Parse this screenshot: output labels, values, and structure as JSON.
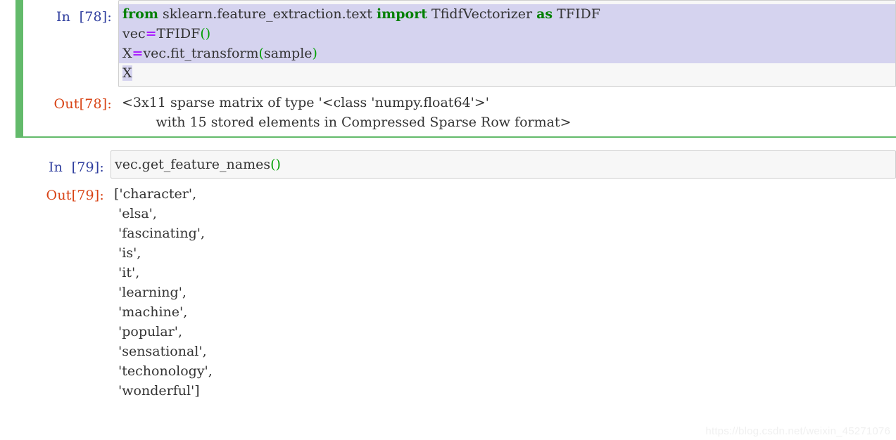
{
  "notebook": {
    "watermark": "https://blog.csdn.net/weixin_45271076",
    "colors": {
      "selection_bar": "#63ba6b",
      "in_prompt": "#303f9f",
      "out_prompt": "#d84315",
      "keyword": "#008000",
      "operator": "#aa22ff",
      "paren": "#00a000",
      "text_selection_highlight": "#d5d3ef",
      "input_background": "#f7f7f7",
      "input_border": "#cfcfcf"
    },
    "cells": [
      {
        "id": "cell-78",
        "selected": true,
        "in_prompt": "In  [78]:",
        "out_prompt": "Out[78]:",
        "code_lines": [
          {
            "selected": "full",
            "tokens": [
              {
                "text": "from",
                "type": "keyword"
              },
              {
                "text": " sklearn.feature_extraction.text ",
                "type": "plain"
              },
              {
                "text": "import",
                "type": "keyword"
              },
              {
                "text": " TfidfVectorizer ",
                "type": "plain"
              },
              {
                "text": "as",
                "type": "keyword"
              },
              {
                "text": " TFIDF",
                "type": "plain"
              }
            ]
          },
          {
            "selected": "full",
            "tokens": [
              {
                "text": "vec",
                "type": "plain"
              },
              {
                "text": "=",
                "type": "operator"
              },
              {
                "text": "TFIDF",
                "type": "plain"
              },
              {
                "text": "()",
                "type": "paren"
              }
            ]
          },
          {
            "selected": "full",
            "tokens": [
              {
                "text": "X",
                "type": "plain"
              },
              {
                "text": "=",
                "type": "operator"
              },
              {
                "text": "vec.fit_transform",
                "type": "plain"
              },
              {
                "text": "(",
                "type": "paren"
              },
              {
                "text": "sample",
                "type": "plain"
              },
              {
                "text": ")",
                "type": "paren"
              }
            ]
          },
          {
            "selected": "partial",
            "tokens": [
              {
                "text": "X",
                "type": "plain"
              }
            ]
          }
        ],
        "output_lines": [
          "<3x11 sparse matrix of type '<class 'numpy.float64'>'",
          "        with 15 stored elements in Compressed Sparse Row format>"
        ]
      },
      {
        "id": "cell-79",
        "selected": false,
        "in_prompt": "In  [79]:",
        "out_prompt": "Out[79]:",
        "code_lines": [
          {
            "selected": "none",
            "tokens": [
              {
                "text": "vec.get_feature_names",
                "type": "plain"
              },
              {
                "text": "()",
                "type": "paren"
              }
            ]
          }
        ],
        "output_lines": [
          "['character',",
          " 'elsa',",
          " 'fascinating',",
          " 'is',",
          " 'it',",
          " 'learning',",
          " 'machine',",
          " 'popular',",
          " 'sensational',",
          " 'techonology',",
          " 'wonderful']"
        ]
      }
    ]
  }
}
